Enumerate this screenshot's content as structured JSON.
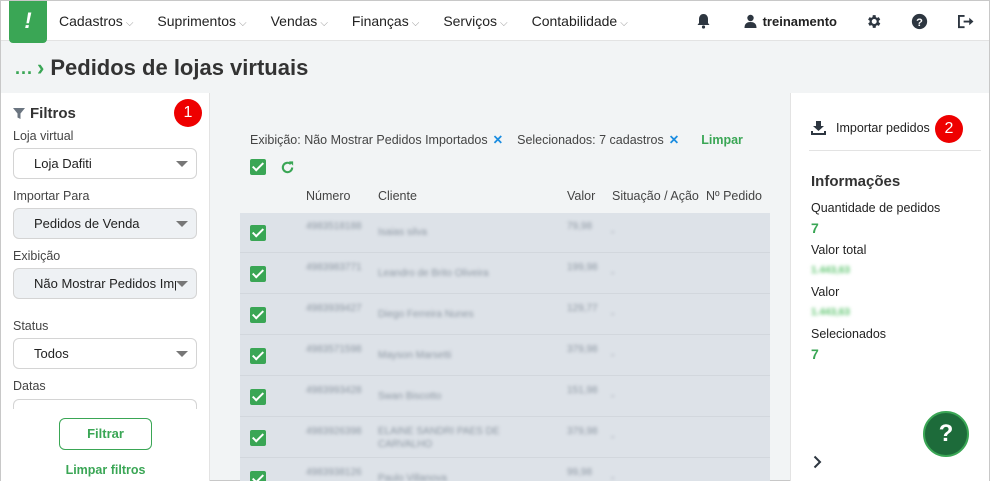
{
  "menu": [
    {
      "label": "Cadastros"
    },
    {
      "label": "Suprimentos"
    },
    {
      "label": "Vendas"
    },
    {
      "label": "Finanças"
    },
    {
      "label": "Serviços"
    },
    {
      "label": "Contabilidade"
    }
  ],
  "user": {
    "name": "treinamento"
  },
  "page": {
    "title": "Pedidos de lojas virtuais",
    "breadcrumb": "..."
  },
  "filters": {
    "title": "Filtros",
    "badge": "1",
    "loja_label": "Loja virtual",
    "loja_value": "Loja Dafiti",
    "importar_label": "Importar Para",
    "importar_value": "Pedidos de Venda",
    "exibicao_label": "Exibição",
    "exibicao_value": "Não Mostrar Pedidos Importados",
    "status_label": "Status",
    "status_value": "Todos",
    "datas_label": "Datas",
    "filtrar_label": "Filtrar",
    "limpar_label": "Limpar filtros"
  },
  "chips": {
    "exibicao": "Exibição: Não Mostrar Pedidos Importados",
    "selecionados": "Selecionados: 7 cadastros",
    "close": "✕",
    "limpar": "Limpar"
  },
  "table": {
    "columns": [
      "Número",
      "Cliente",
      "Valor",
      "Situação / Ação",
      "Nº Pedido"
    ],
    "rows": [
      {
        "numero": "4983518188",
        "cliente": "Isaias silva",
        "valor": "79,98",
        "situacao": "-"
      },
      {
        "numero": "4983983771",
        "cliente": "Leandro de Brito Oliveira",
        "valor": "199,98",
        "situacao": "-"
      },
      {
        "numero": "4983939427",
        "cliente": "Diego Ferreira Nunes",
        "valor": "129,77",
        "situacao": "-"
      },
      {
        "numero": "4983571598",
        "cliente": "Mayson Marsetti",
        "valor": "379,98",
        "situacao": "-"
      },
      {
        "numero": "4983993428",
        "cliente": "Swan Biscotto",
        "valor": "151,98",
        "situacao": "-"
      },
      {
        "numero": "4983926398",
        "cliente": "ELAINE SANDRI PAES DE CARVALHO",
        "valor": "379,98",
        "situacao": "-"
      },
      {
        "numero": "4983938126",
        "cliente": "Paulo Villanova",
        "valor": "99,98",
        "situacao": "-"
      }
    ]
  },
  "right": {
    "import_label": "Importar pedidos",
    "badge": "2",
    "info_title": "Informações",
    "qtd_label": "Quantidade de pedidos",
    "qtd_value": "7",
    "valor_total_label": "Valor total",
    "valor_total_value": "1.443,63",
    "valor_label": "Valor",
    "valor_value": "1.443,63",
    "selecionados_label": "Selecionados",
    "selecionados_value": "7",
    "help": "?"
  },
  "icons": {
    "logo": "!",
    "bell": "bell-icon",
    "user": "user-icon",
    "gear": "gear-icon",
    "help": "help-circle-icon",
    "logout": "logout-icon",
    "funnel": "funnel-icon",
    "download": "download-icon",
    "refresh": "refresh-icon",
    "chevron_right": "chevron-right-icon"
  },
  "colors": {
    "accent": "#3aa655",
    "badge": "#e00000",
    "link_blue": "#1a8ce0",
    "table_bg": "#dde2e8"
  }
}
